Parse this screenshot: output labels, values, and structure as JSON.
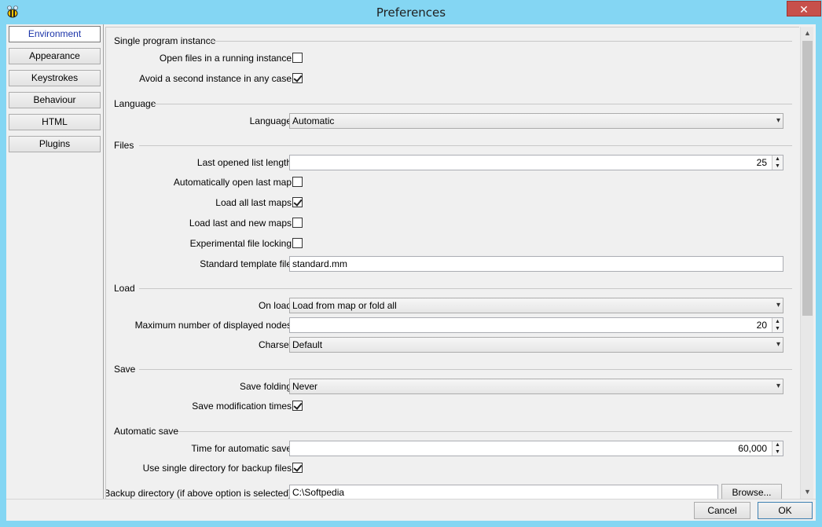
{
  "window": {
    "title": "Preferences",
    "close_glyph": "✕",
    "app_icon": "bee-icon"
  },
  "nav": {
    "items": [
      {
        "label": "Environment",
        "active": true
      },
      {
        "label": "Appearance"
      },
      {
        "label": "Keystrokes"
      },
      {
        "label": "Behaviour"
      },
      {
        "label": "HTML"
      },
      {
        "label": "Plugins"
      }
    ]
  },
  "sections": {
    "single": {
      "title": "Single program instance",
      "open_files_label": "Open files in a running instance",
      "open_files_checked": false,
      "avoid_second_label": "Avoid a second instance in any case",
      "avoid_second_checked": true
    },
    "language": {
      "title": "Language",
      "language_label": "Language",
      "language_value": "Automatic"
    },
    "files": {
      "title": "Files",
      "last_list_label": "Last opened list length",
      "last_list_value": "25",
      "auto_open_label": "Automatically open last map",
      "auto_open_checked": false,
      "load_all_label": "Load all last maps",
      "load_all_checked": true,
      "load_last_new_label": "Load last and new maps",
      "load_last_new_checked": false,
      "locking_label": "Experimental file locking",
      "locking_checked": false,
      "template_label": "Standard template file",
      "template_value": "standard.mm"
    },
    "load": {
      "title": "Load",
      "on_load_label": "On load",
      "on_load_value": "Load from map or fold all",
      "max_nodes_label": "Maximum number of displayed nodes",
      "max_nodes_value": "20",
      "charset_label": "Charset",
      "charset_value": "Default"
    },
    "save": {
      "title": "Save",
      "folding_label": "Save folding",
      "folding_value": "Never",
      "mod_times_label": "Save modification times",
      "mod_times_checked": true
    },
    "autosave": {
      "title": "Automatic save",
      "time_label": "Time for automatic save",
      "time_value": "60,000",
      "single_dir_label": "Use single directory for backup files",
      "single_dir_checked": true,
      "backup_dir_label": "Backup directory (if above option is selected)",
      "backup_dir_value": "C:\\Softpedia",
      "browse_label": "Browse..."
    }
  },
  "footer": {
    "cancel_label": "Cancel",
    "ok_label": "OK"
  },
  "icons": {
    "dropdown": "▾",
    "spin_up": "▲",
    "spin_down": "▼",
    "scroll_up": "▲",
    "scroll_down": "▼"
  }
}
